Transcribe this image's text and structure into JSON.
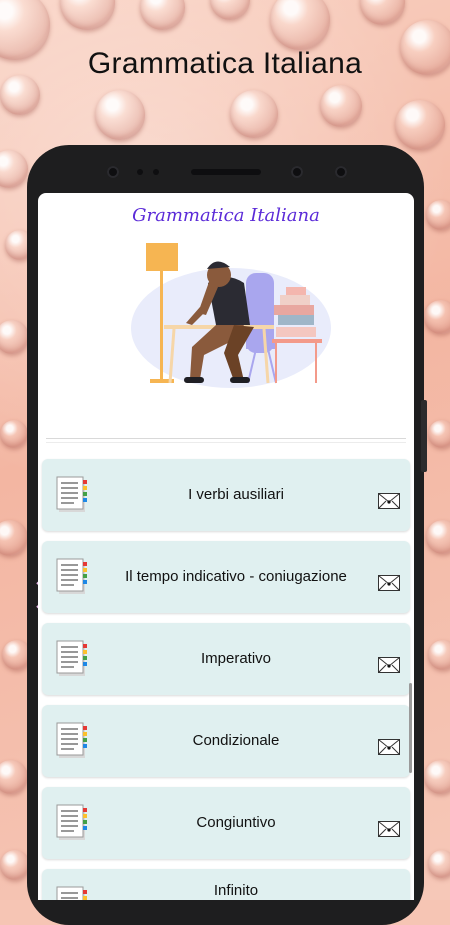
{
  "promo_headline": "Grammatica Italiana",
  "app": {
    "title": "Grammatica Italiana"
  },
  "lessons": [
    {
      "label": "I verbi ausiliari"
    },
    {
      "label": "Il tempo indicativo - coniugazione"
    },
    {
      "label": "Imperativo"
    },
    {
      "label": "Condizionale"
    },
    {
      "label": "Congiuntivo"
    },
    {
      "label": "Infinito"
    }
  ],
  "icons": {
    "lesson_icon": "document-icon",
    "action_icon": "envelope-icon"
  },
  "colors": {
    "app_title": "#5b2bd8",
    "item_background": "#e0f0f0",
    "phone_frame": "#1e1e1f"
  }
}
